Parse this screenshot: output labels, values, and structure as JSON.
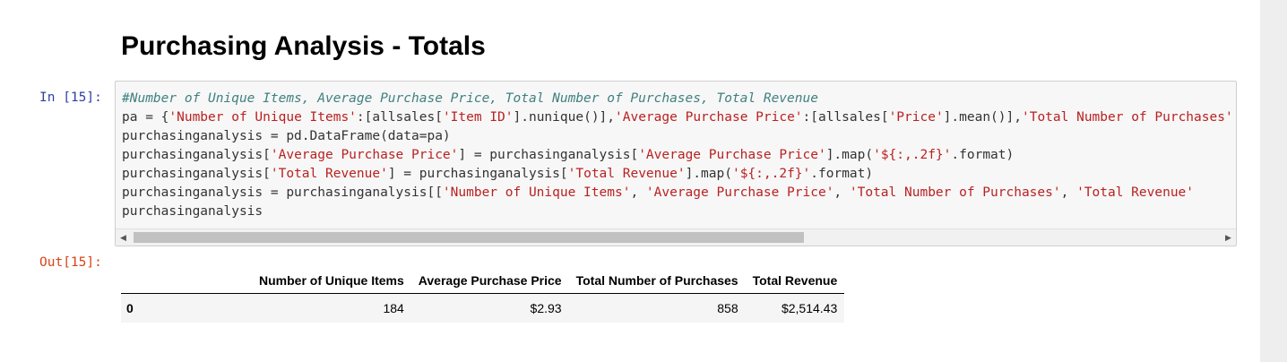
{
  "notebook": {
    "heading": "Purchasing Analysis - Totals",
    "input_prompt": "In [15]:",
    "output_prompt": "Out[15]:",
    "code_lines": [
      [
        {
          "t": "#Number of Unique Items, Average Purchase Price, Total Number of Purchases, Total Revenue",
          "k": "c"
        }
      ],
      [
        {
          "t": "pa = {",
          "k": "o"
        },
        {
          "t": "'Number of Unique Items'",
          "k": "s"
        },
        {
          "t": ":[allsales[",
          "k": "o"
        },
        {
          "t": "'Item ID'",
          "k": "s"
        },
        {
          "t": "].nunique()],",
          "k": "o"
        },
        {
          "t": "'Average Purchase Price'",
          "k": "s"
        },
        {
          "t": ":[allsales[",
          "k": "o"
        },
        {
          "t": "'Price'",
          "k": "s"
        },
        {
          "t": "].mean()],",
          "k": "o"
        },
        {
          "t": "'Total Number of Purchases'",
          "k": "s"
        }
      ],
      [
        {
          "t": "purchasinganalysis = pd.DataFrame(data=pa)",
          "k": "o"
        }
      ],
      [
        {
          "t": "purchasinganalysis[",
          "k": "o"
        },
        {
          "t": "'Average Purchase Price'",
          "k": "s"
        },
        {
          "t": "] = purchasinganalysis[",
          "k": "o"
        },
        {
          "t": "'Average Purchase Price'",
          "k": "s"
        },
        {
          "t": "].map(",
          "k": "o"
        },
        {
          "t": "'${:,.2f}'",
          "k": "s"
        },
        {
          "t": ".format)",
          "k": "o"
        }
      ],
      [
        {
          "t": "purchasinganalysis[",
          "k": "o"
        },
        {
          "t": "'Total Revenue'",
          "k": "s"
        },
        {
          "t": "] = purchasinganalysis[",
          "k": "o"
        },
        {
          "t": "'Total Revenue'",
          "k": "s"
        },
        {
          "t": "].map(",
          "k": "o"
        },
        {
          "t": "'${:,.2f}'",
          "k": "s"
        },
        {
          "t": ".format)",
          "k": "o"
        }
      ],
      [
        {
          "t": "purchasinganalysis = purchasinganalysis[[",
          "k": "o"
        },
        {
          "t": "'Number of Unique Items'",
          "k": "s"
        },
        {
          "t": ", ",
          "k": "o"
        },
        {
          "t": "'Average Purchase Price'",
          "k": "s"
        },
        {
          "t": ", ",
          "k": "o"
        },
        {
          "t": "'Total Number of Purchases'",
          "k": "s"
        },
        {
          "t": ", ",
          "k": "o"
        },
        {
          "t": "'Total Revenue'",
          "k": "s"
        }
      ],
      [
        {
          "t": "purchasinganalysis",
          "k": "o"
        }
      ]
    ],
    "table": {
      "columns": [
        "Number of Unique Items",
        "Average Purchase Price",
        "Total Number of Purchases",
        "Total Revenue"
      ],
      "rows": [
        {
          "index": "0",
          "values": [
            "184",
            "$2.93",
            "858",
            "$2,514.43"
          ]
        }
      ]
    }
  }
}
